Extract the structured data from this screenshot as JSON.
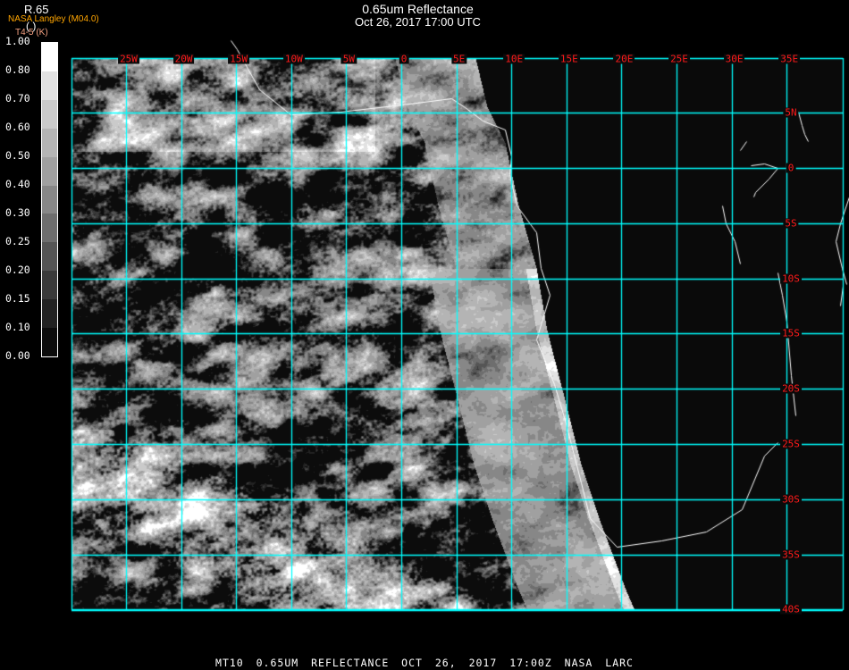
{
  "header": {
    "title": "0.65um Reflectance",
    "datetime": "Oct 26, 2017 17:00 UTC",
    "source": "NASA Langley (M04.0)",
    "variable": "R.65",
    "variable_units": "(    )",
    "overlay_label": "T4-5 (K)"
  },
  "colorbar": {
    "labels": [
      "0.00",
      "0.10",
      "0.15",
      "0.20",
      "0.25",
      "0.30",
      "0.40",
      "0.50",
      "0.60",
      "0.70",
      "0.80",
      "1.00"
    ],
    "colors": [
      "#0c0c0c",
      "#222222",
      "#3a3a3a",
      "#555555",
      "#6e6e6e",
      "#878787",
      "#a0a0a0",
      "#b4b4b4",
      "#cacaca",
      "#e2e2e2",
      "#ffffff"
    ]
  },
  "map": {
    "grid_color": "#00ffff",
    "label_color": "#ff1a1a",
    "coastline_color": "#ffffff",
    "land_color": "#0a0a0a",
    "lon_labels": [
      "25W",
      "20W",
      "15W",
      "10W",
      "5W",
      "0",
      "5E",
      "10E",
      "15E",
      "20E",
      "25E",
      "30E",
      "35E"
    ],
    "lon_values": [
      -25,
      -20,
      -15,
      -10,
      -5,
      0,
      5,
      10,
      15,
      20,
      25,
      30,
      35
    ],
    "lat_labels": [
      "5N",
      "0",
      "5S",
      "10S",
      "15S",
      "20S",
      "25S",
      "30S",
      "35S",
      "40S"
    ],
    "lat_values": [
      5,
      0,
      -5,
      -10,
      -15,
      -20,
      -25,
      -30,
      -35,
      -40
    ]
  },
  "footer": "MT10  0.65UM REFLECTANCE   OCT 26, 2017 17:00Z   NASA LARC"
}
